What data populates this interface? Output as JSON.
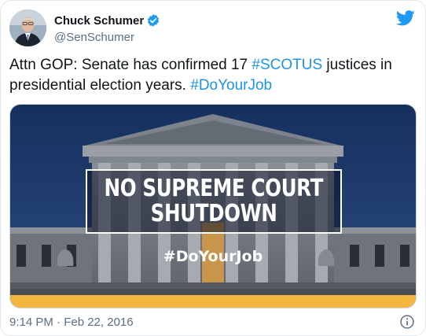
{
  "author": {
    "name": "Chuck Schumer",
    "handle": "@SenSchumer"
  },
  "tweet": {
    "text_before": "Attn GOP: Senate has confirmed 17 ",
    "hashtag_1": "#SCOTUS",
    "text_middle": " justices in presidential election years. ",
    "hashtag_2": "#DoYourJob"
  },
  "media": {
    "banner_line_1": "NO SUPREME COURT",
    "banner_line_2": "SHUTDOWN",
    "image_hashtag": "#DoYourJob"
  },
  "footer": {
    "timestamp": "9:14 PM · Feb 22, 2016"
  },
  "colors": {
    "accent": "#1b95e0",
    "verified": "#1d9bf0",
    "sky": "#1f3a6e",
    "stripe": "#f5b640"
  },
  "icons": {
    "brand": "twitter-bird-icon",
    "verified": "verified-badge-icon",
    "info": "info-icon"
  }
}
